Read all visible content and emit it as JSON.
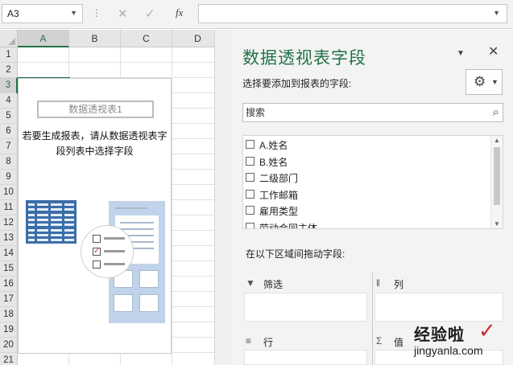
{
  "formula_bar": {
    "name_box": "A3",
    "dots": "⋮",
    "cancel_icon": "✕",
    "enter_icon": "✓",
    "fx_label": "fx",
    "formula_value": ""
  },
  "grid": {
    "columns": [
      "A",
      "B",
      "C",
      "D"
    ],
    "selected_column": "A",
    "rows": [
      "1",
      "2",
      "3",
      "4",
      "5",
      "6",
      "7",
      "8",
      "9",
      "10",
      "11",
      "12",
      "13",
      "14",
      "15",
      "16",
      "17",
      "18",
      "19",
      "20",
      "21"
    ],
    "selected_row": "3",
    "active_cell": "A3"
  },
  "pivot_placeholder": {
    "title": "数据透视表1",
    "message_line1": "若要生成报表，请从数据透视表字",
    "message_line2": "段列表中选择字段"
  },
  "pane": {
    "title": "数据透视表字段",
    "subtitle": "选择要添加到报表的字段:",
    "search_placeholder": "搜索",
    "fields": [
      "A.姓名",
      "B.姓名",
      "二级部门",
      "工作邮箱",
      "雇用类型",
      "劳动合同主体"
    ],
    "drag_label": "在以下区域间拖动字段:",
    "areas": {
      "filter": "筛选",
      "columns": "列",
      "rows": "行",
      "values": "值"
    },
    "icons": {
      "collapse": "chevron-down-icon",
      "close": "close-icon",
      "settings": "gear-icon",
      "search": "search-icon"
    }
  },
  "watermark": {
    "text_top": "经验啦",
    "text_bottom": "jingyanla.com"
  },
  "colors": {
    "accent": "#217346",
    "pane_bg": "#f3f3f3",
    "illus_blue": "#3b6ea8",
    "illus_light": "#c1d3ea"
  }
}
